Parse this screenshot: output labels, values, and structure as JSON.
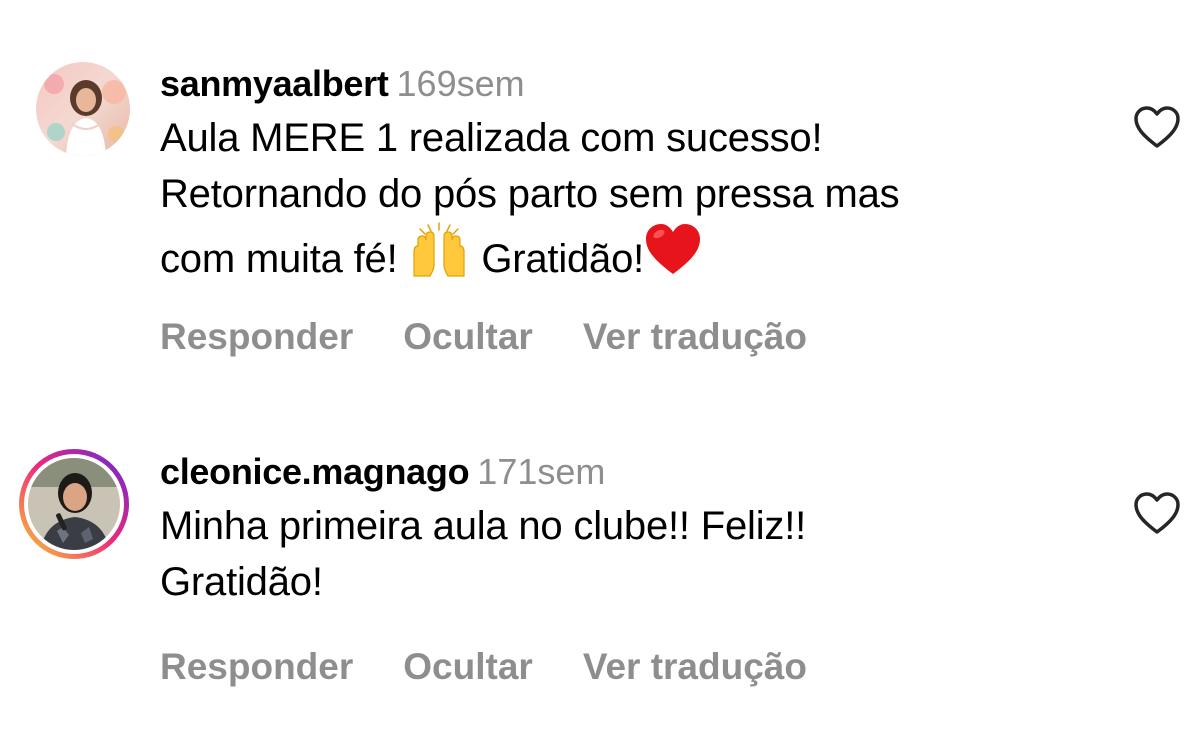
{
  "comments": [
    {
      "username": "sanmyaalbert",
      "time": "169sem",
      "text_line1": "Aula MERE 1 realizada com sucesso!",
      "text_line2": "Retornando do pós parto sem pressa mas",
      "text_line3_a": "com muita fé! ",
      "text_line3_b": " Gratidão!",
      "emoji_1": "raising-hands-icon",
      "emoji_2": "red-heart-icon",
      "actions": {
        "reply": "Responder",
        "hide": "Ocultar",
        "translate": "Ver tradução"
      },
      "avatar_story_ring": false
    },
    {
      "username": "cleonice.magnago",
      "time": "171sem",
      "text_line1": "Minha primeira aula no clube!! Feliz!!",
      "text_line2": "Gratidão!",
      "actions": {
        "reply": "Responder",
        "hide": "Ocultar",
        "translate": "Ver tradução"
      },
      "avatar_story_ring": true
    }
  ],
  "colors": {
    "secondary_text": "#8e8e8e",
    "story_ring_start": "#f9ce34",
    "story_ring_mid": "#ee2a7b",
    "story_ring_end": "#6228d7"
  }
}
